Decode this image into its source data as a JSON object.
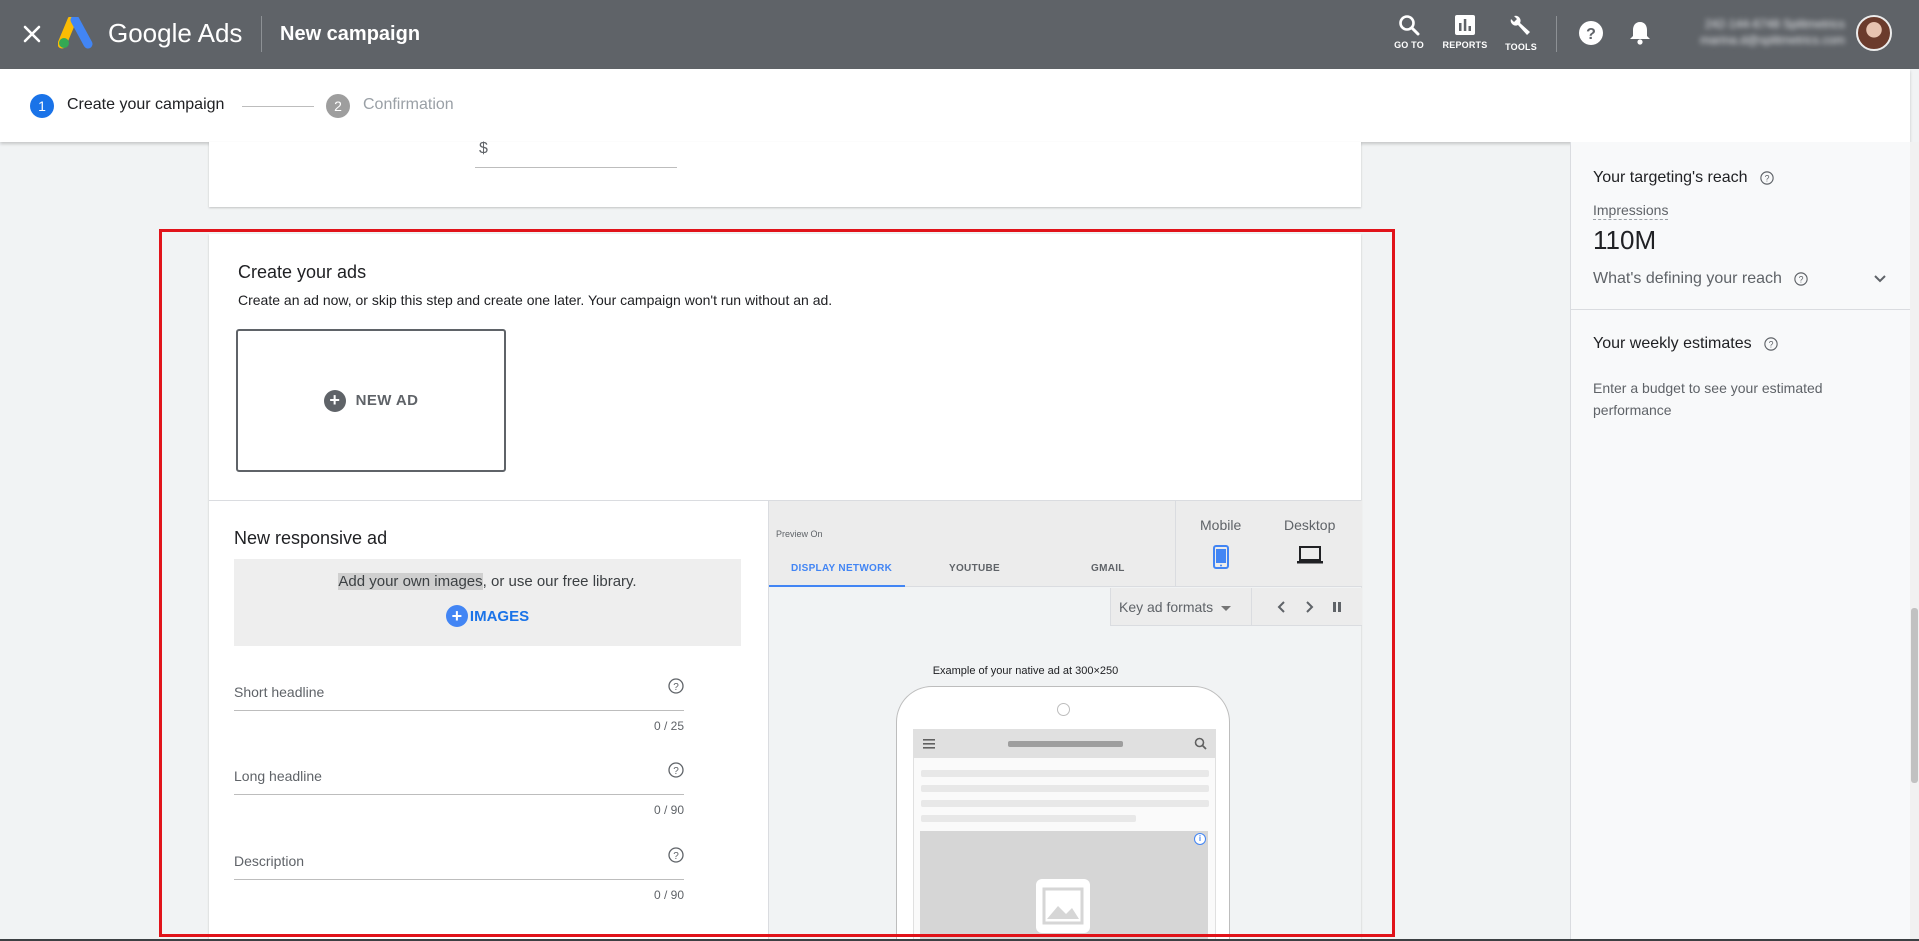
{
  "header": {
    "brand": "Google Ads",
    "page_title": "New campaign",
    "tools": [
      {
        "label": "GO TO",
        "icon": "search-icon"
      },
      {
        "label": "REPORTS",
        "icon": "bar-chart-icon"
      },
      {
        "label": "TOOLS",
        "icon": "wrench-icon"
      }
    ],
    "account_line1": "242-144-6748 Splitmetrics",
    "account_line2": "marina.d@splitmetrics.com"
  },
  "stepper": {
    "steps": [
      {
        "number": "1",
        "label": "Create your campaign",
        "state": "active"
      },
      {
        "number": "2",
        "label": "Confirmation",
        "state": "inactive"
      }
    ]
  },
  "budget": {
    "currency_symbol": "$"
  },
  "create_ads": {
    "title": "Create your ads",
    "subtitle": "Create an ad now, or skip this step and create one later. Your campaign won't run without an ad.",
    "new_ad_label": "NEW AD"
  },
  "responsive_ad": {
    "title": "New responsive ad",
    "images_prompt_highlight": "Add your own images",
    "images_prompt_rest": ", or use our free library.",
    "images_button": "IMAGES",
    "fields": [
      {
        "placeholder": "Short headline",
        "counter": "0 / 25"
      },
      {
        "placeholder": "Long headline",
        "counter": "0 / 90"
      },
      {
        "placeholder": "Description",
        "counter": "0 / 90"
      }
    ]
  },
  "preview": {
    "preview_on": "Preview On",
    "tabs": [
      "DISPLAY NETWORK",
      "YOUTUBE",
      "GMAIL"
    ],
    "active_tab": "DISPLAY NETWORK",
    "devices": [
      "Mobile",
      "Desktop"
    ],
    "active_device": "Mobile",
    "format_select": "Key ad formats",
    "example_caption": "Example of your native ad at 300×250"
  },
  "sidebar": {
    "reach_title": "Your targeting's reach",
    "impressions_label": "Impressions",
    "impressions_value": "110M",
    "defining_label": "What's defining your reach",
    "weekly_title": "Your weekly estimates",
    "weekly_note": "Enter a budget to see your estimated performance"
  },
  "colors": {
    "topbar": "#5f6368",
    "accent": "#4285f4",
    "highlight_border": "#e1131a"
  }
}
